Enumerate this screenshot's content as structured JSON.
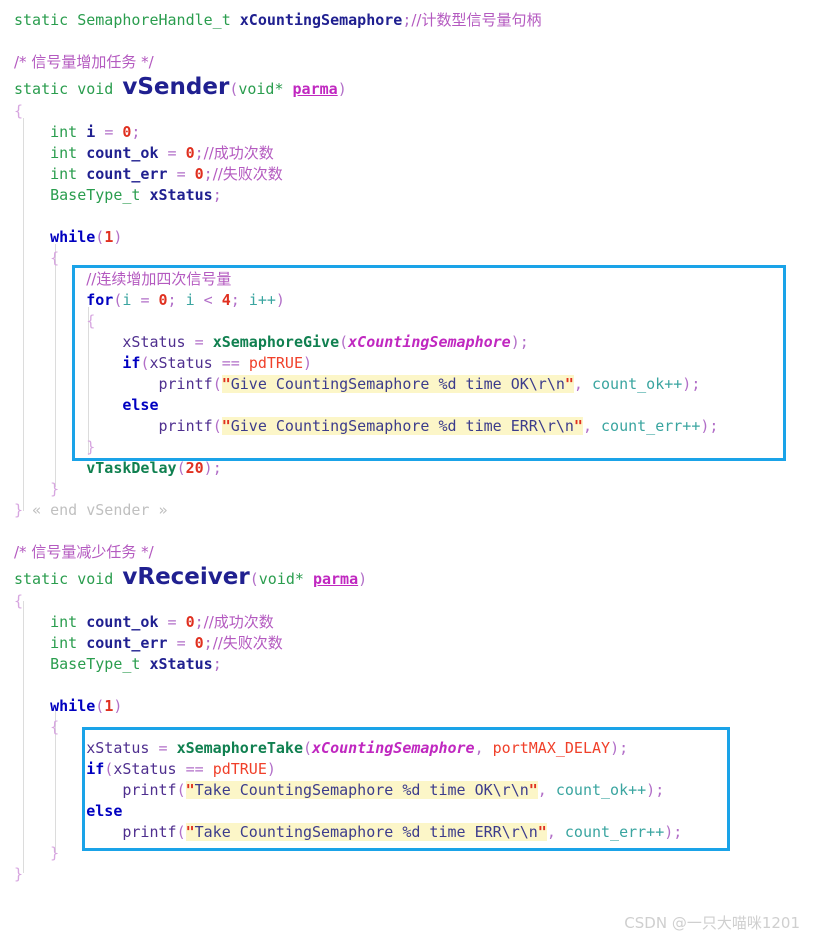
{
  "document": {
    "kind": "source-code-screenshot",
    "language": "C",
    "theme": {
      "background": "#ffffff",
      "keyword": "#0000c0",
      "type": "#2a9d4e",
      "function": "#108050",
      "variable": "#202090",
      "number": "#e03020",
      "macro": "#f0402a",
      "comment": "#b45ac0",
      "punctuation": "#b26fc8",
      "brace": "#d7a6e0",
      "global_arg": "#c028c0",
      "string_bg": "#fcf6c8",
      "highlight_box": "#1aa3e8",
      "end_marker": "#c0c0c0",
      "watermark": "#cfcfcf"
    }
  },
  "code": {
    "line_01_static": "static",
    "line_01_type": "SemaphoreHandle_t",
    "line_01_var": "xCountingSemaphore",
    "line_01_semi": ";",
    "line_01_comment": "//计数型信号量句柄",
    "line_03_comment": "/* 信号量增加任务 */",
    "line_04_static": "static",
    "line_04_void": "void",
    "line_04_name": "vSender",
    "line_04_open": "(",
    "line_04_argtype": "void*",
    "line_04_argname": "parma",
    "line_04_close": ")",
    "line_05_brace": "{",
    "line_06_type": "int",
    "line_06_name": "i",
    "line_06_eq": "=",
    "line_06_val": "0",
    "line_06_semi": ";",
    "line_07_type": "int",
    "line_07_name": "count_ok",
    "line_07_eq": "=",
    "line_07_val": "0",
    "line_07_semi": ";",
    "line_07_comment": "//成功次数",
    "line_08_type": "int",
    "line_08_name": "count_err",
    "line_08_eq": "=",
    "line_08_val": "0",
    "line_08_semi": ";",
    "line_08_comment": "//失败次数",
    "line_09_type": "BaseType_t",
    "line_09_name": "xStatus",
    "line_09_semi": ";",
    "line_11_kw": "while",
    "line_11_open": "(",
    "line_11_val": "1",
    "line_11_close": ")",
    "line_12_brace": "{",
    "line_13_comment": "//连续增加四次信号量",
    "line_14_kw": "for",
    "line_14_open": "(",
    "line_14_i1": "i",
    "line_14_eq": "=",
    "line_14_zero": "0",
    "line_14_semi1": ";",
    "line_14_i2": "i",
    "line_14_lt": "<",
    "line_14_four": "4",
    "line_14_semi2": ";",
    "line_14_inc": "i++",
    "line_14_close": ")",
    "line_15_brace": "{",
    "line_16_lhs": "xStatus",
    "line_16_eq": "=",
    "line_16_fn": "xSemaphoreGive",
    "line_16_open": "(",
    "line_16_arg": "xCountingSemaphore",
    "line_16_close": ")",
    "line_16_semi": ";",
    "line_17_kw": "if",
    "line_17_open": "(",
    "line_17_lhs": "xStatus",
    "line_17_op": "==",
    "line_17_rhs": "pdTRUE",
    "line_17_close": ")",
    "line_18_fn": "printf",
    "line_18_open": "(",
    "line_18_quote_open": "\"",
    "line_18_str": "Give CountingSemaphore %d time OK\\r\\n",
    "line_18_quote_close": "\"",
    "line_18_comma": ",",
    "line_18_arg": "count_ok++",
    "line_18_close": ")",
    "line_18_semi": ";",
    "line_19_kw": "else",
    "line_20_fn": "printf",
    "line_20_open": "(",
    "line_20_quote_open": "\"",
    "line_20_str": "Give CountingSemaphore %d time ERR\\r\\n",
    "line_20_quote_close": "\"",
    "line_20_comma": ",",
    "line_20_arg": "count_err++",
    "line_20_close": ")",
    "line_20_semi": ";",
    "line_21_brace": "}",
    "line_22_fn": "vTaskDelay",
    "line_22_open": "(",
    "line_22_val": "20",
    "line_22_close": ")",
    "line_22_semi": ";",
    "line_23_brace": "}",
    "line_24_brace": "}",
    "line_24_end": "« end vSender »",
    "line_26_comment": "/* 信号量减少任务 */",
    "line_27_static": "static",
    "line_27_void": "void",
    "line_27_name": "vReceiver",
    "line_27_open": "(",
    "line_27_argtype": "void*",
    "line_27_argname": "parma",
    "line_27_close": ")",
    "line_28_brace": "{",
    "line_29_type": "int",
    "line_29_name": "count_ok",
    "line_29_eq": "=",
    "line_29_val": "0",
    "line_29_semi": ";",
    "line_29_comment": "//成功次数",
    "line_30_type": "int",
    "line_30_name": "count_err",
    "line_30_eq": "=",
    "line_30_val": "0",
    "line_30_semi": ";",
    "line_30_comment": "//失败次数",
    "line_31_type": "BaseType_t",
    "line_31_name": "xStatus",
    "line_31_semi": ";",
    "line_33_kw": "while",
    "line_33_open": "(",
    "line_33_val": "1",
    "line_33_close": ")",
    "line_34_brace": "{",
    "line_35_lhs": "xStatus",
    "line_35_eq": "=",
    "line_35_fn": "xSemaphoreTake",
    "line_35_open": "(",
    "line_35_arg1": "xCountingSemaphore",
    "line_35_comma": ",",
    "line_35_arg2": "portMAX_DELAY",
    "line_35_close": ")",
    "line_35_semi": ";",
    "line_36_kw": "if",
    "line_36_open": "(",
    "line_36_lhs": "xStatus",
    "line_36_op": "==",
    "line_36_rhs": "pdTRUE",
    "line_36_close": ")",
    "line_37_fn": "printf",
    "line_37_open": "(",
    "line_37_quote_open": "\"",
    "line_37_str": "Take CountingSemaphore %d time OK\\r\\n",
    "line_37_quote_close": "\"",
    "line_37_comma": ",",
    "line_37_arg": "count_ok++",
    "line_37_close": ")",
    "line_37_semi": ";",
    "line_38_kw": "else",
    "line_39_fn": "printf",
    "line_39_open": "(",
    "line_39_quote_open": "\"",
    "line_39_str": "Take CountingSemaphore %d time ERR\\r\\n",
    "line_39_quote_close": "\"",
    "line_39_comma": ",",
    "line_39_arg": "count_err++",
    "line_39_close": ")",
    "line_39_semi": ";",
    "line_40_brace": "}",
    "line_41_brace": "}"
  },
  "watermark": {
    "text": "CSDN @一只大喵咪1201"
  }
}
